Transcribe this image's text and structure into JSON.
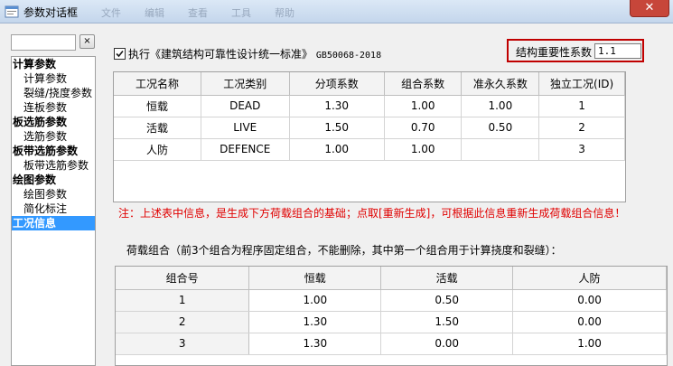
{
  "window": {
    "title": "参数对话框",
    "ghost_menu": [
      "文件",
      "编辑",
      "查看",
      "工具",
      "帮助"
    ],
    "close_glyph": "✕"
  },
  "sidebar": {
    "clear_label": "×",
    "items": [
      {
        "label": "计算参数",
        "level": 0
      },
      {
        "label": "计算参数",
        "level": 1
      },
      {
        "label": "裂缝/挠度参数",
        "level": 1
      },
      {
        "label": "连板参数",
        "level": 1
      },
      {
        "label": "板选筋参数",
        "level": 0
      },
      {
        "label": "选筋参数",
        "level": 1
      },
      {
        "label": "板带选筋参数",
        "level": 0
      },
      {
        "label": "板带选筋参数",
        "level": 1
      },
      {
        "label": "绘图参数",
        "level": 0
      },
      {
        "label": "绘图参数",
        "level": 1
      },
      {
        "label": "简化标注",
        "level": 1
      },
      {
        "label": "工况信息",
        "level": 0,
        "selected": true
      }
    ]
  },
  "standard_check": {
    "checked": true,
    "label_text": "执行《建筑结构可靠性设计统一标准》",
    "label_code": "GB50068-2018"
  },
  "importance": {
    "label": "结构重要性系数",
    "value": "1.1"
  },
  "case_table": {
    "headers": [
      "工况名称",
      "工况类别",
      "分项系数",
      "组合系数",
      "准永久系数",
      "独立工况(ID)"
    ],
    "rows": [
      [
        "恒载",
        "DEAD",
        "1.30",
        "1.00",
        "1.00",
        "1"
      ],
      [
        "活载",
        "LIVE",
        "1.50",
        "0.70",
        "0.50",
        "2"
      ],
      [
        "人防",
        "DEFENCE",
        "1.00",
        "1.00",
        "",
        "3"
      ]
    ]
  },
  "note": "注：上述表中信息，是生成下方荷载组合的基础；点取[重新生成]，可根据此信息重新生成荷载组合信息！",
  "combo": {
    "title": "荷载组合（前3个组合为程序固定组合，不能删除，其中第一个组合用于计算挠度和裂缝）：",
    "headers": [
      "组合号",
      "恒载",
      "活载",
      "人防"
    ],
    "rows": [
      [
        "1",
        "1.00",
        "0.50",
        "0.00"
      ],
      [
        "2",
        "1.30",
        "1.50",
        "0.00"
      ],
      [
        "3",
        "1.30",
        "0.00",
        "1.00"
      ]
    ]
  }
}
